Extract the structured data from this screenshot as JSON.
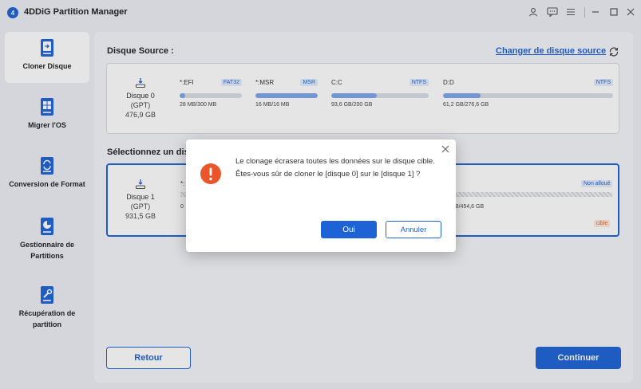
{
  "app": {
    "title": "4DDiG Partition Manager",
    "logo_letter": "4"
  },
  "sidebar": {
    "items": [
      {
        "label": "Cloner Disque"
      },
      {
        "label": "Migrer l'OS"
      },
      {
        "label": "Conversion de Format"
      },
      {
        "label": "Gestionnaire de Partitions"
      },
      {
        "label": "Récupération de partition"
      }
    ]
  },
  "source": {
    "title": "Disque Source :",
    "change_link": "Changer de disque source",
    "disk": {
      "name": "Disque 0",
      "type": "(GPT)",
      "size": "476,9 GB"
    },
    "partitions": [
      {
        "name": "*:EFI",
        "tag": "FAT32",
        "size": "28 MB/300 MB",
        "used_pct": 9
      },
      {
        "name": "*:MSR",
        "tag": "MSR",
        "size": "16 MB/16 MB",
        "used_pct": 100
      },
      {
        "name": "C:C",
        "tag": "NTFS",
        "size": "93,6 GB/200 GB",
        "used_pct": 47
      },
      {
        "name": "D:D",
        "tag": "NTFS",
        "size": "61,2 GB/276,6 GB",
        "used_pct": 22
      }
    ]
  },
  "target": {
    "title_visible": "Sélectionnez un disq",
    "disk": {
      "name": "Disque 1",
      "type": "(GPT)",
      "size": "931,5 GB"
    },
    "partition_name_fragment": "*:",
    "size_fragment_left": "0",
    "size_fragment_right": "/B/454,6 GB",
    "unallocated": "Non alloué",
    "badge": "cible"
  },
  "buttons": {
    "back": "Retour",
    "continue": "Continuer"
  },
  "dialog": {
    "message": "Le clonage écrasera toutes les données sur le disque cible. Êtes-vous sûr de cloner le [disque 0] sur le [disque 1] ?",
    "ok": "Oui",
    "cancel": "Annuler"
  },
  "colors": {
    "accent": "#1e63d6",
    "warning": "#e8562a",
    "target_badge": "#e06a2b"
  }
}
